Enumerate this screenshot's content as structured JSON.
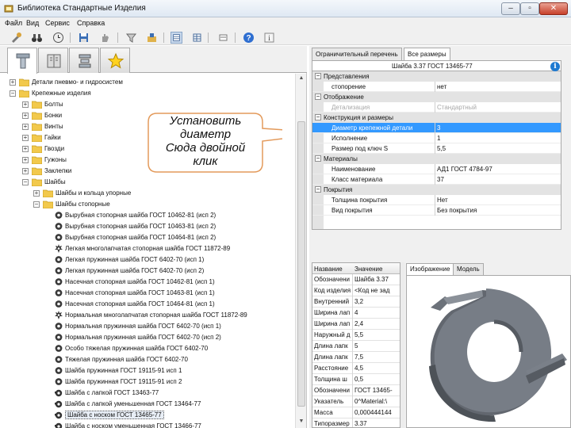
{
  "window": {
    "title": "Библиотека Стандартные Изделия"
  },
  "menu": [
    "Файл",
    "Вид",
    "Сервис",
    "Справка"
  ],
  "toolbar": {
    "icons": [
      "properties-icon",
      "binoculars-icon",
      "clock-icon",
      "save-icon",
      "hand-icon",
      "filter-icon",
      "edit-icon",
      "grid-view-icon",
      "table-view-icon",
      "list-view-icon",
      "help-icon",
      "info-icon"
    ]
  },
  "tree": {
    "rows": [
      {
        "label": "Детали пневмо- и гидросистем",
        "kind": "folder",
        "level": 0,
        "expander": "+"
      },
      {
        "label": "Крепежные изделия",
        "kind": "folder",
        "level": 0,
        "expander": "−"
      },
      {
        "label": "Болты",
        "kind": "folder",
        "level": 1,
        "expander": "+"
      },
      {
        "label": "Бонки",
        "kind": "folder",
        "level": 1,
        "expander": "+"
      },
      {
        "label": "Винты",
        "kind": "folder",
        "level": 1,
        "expander": "+"
      },
      {
        "label": "Гайки",
        "kind": "folder",
        "level": 1,
        "expander": "+"
      },
      {
        "label": "Гвозди",
        "kind": "folder",
        "level": 1,
        "expander": "+"
      },
      {
        "label": "Гужоны",
        "kind": "folder",
        "level": 1,
        "expander": "+"
      },
      {
        "label": "Заклепки",
        "kind": "folder",
        "level": 1,
        "expander": "+"
      },
      {
        "label": "Шайбы",
        "kind": "folder",
        "level": 1,
        "expander": "−"
      },
      {
        "label": "Шайбы и кольца упорные",
        "kind": "folder",
        "level": 2,
        "expander": "+"
      },
      {
        "label": "Шайбы стопорные",
        "kind": "folder",
        "level": 2,
        "expander": "−"
      },
      {
        "label": "Вырубная стопорная шайба ГОСТ 10462-81 (исп 2)",
        "kind": "item",
        "level": 3
      },
      {
        "label": "Вырубная стопорная шайба ГОСТ 10463-81 (исп 2)",
        "kind": "item",
        "level": 3
      },
      {
        "label": "Вырубная стопорная шайба ГОСТ 10464-81 (исп 2)",
        "kind": "item",
        "level": 3
      },
      {
        "label": "Легкая многолапчатая стопорная шайба ГОСТ 11872-89",
        "kind": "item",
        "level": 3
      },
      {
        "label": "Легкая пружинная шайба ГОСТ 6402-70 (исп 1)",
        "kind": "item",
        "level": 3
      },
      {
        "label": "Легкая пружинная шайба ГОСТ 6402-70 (исп 2)",
        "kind": "item",
        "level": 3
      },
      {
        "label": "Насечная стопорная шайба ГОСТ 10462-81 (исп 1)",
        "kind": "item",
        "level": 3
      },
      {
        "label": "Насечная стопорная шайба ГОСТ 10463-81 (исп 1)",
        "kind": "item",
        "level": 3
      },
      {
        "label": "Насечная стопорная шайба ГОСТ 10464-81 (исп 1)",
        "kind": "item",
        "level": 3
      },
      {
        "label": "Нормальная многолапчатая стопорная шайба ГОСТ 11872-89",
        "kind": "item",
        "level": 3
      },
      {
        "label": "Нормальная пружинная шайба ГОСТ 6402-70 (исп 1)",
        "kind": "item",
        "level": 3
      },
      {
        "label": "Нормальная пружинная шайба ГОСТ 6402-70 (исп 2)",
        "kind": "item",
        "level": 3
      },
      {
        "label": "Особо тяжелая пружинная шайба ГОСТ 6402-70",
        "kind": "item",
        "level": 3
      },
      {
        "label": "Тяжелая пружинная шайба ГОСТ 6402-70",
        "kind": "item",
        "level": 3
      },
      {
        "label": "Шайба пружинная ГОСТ 19115-91 исп 1",
        "kind": "item",
        "level": 3
      },
      {
        "label": "Шайба пружинная ГОСТ 19115-91 исп 2",
        "kind": "item",
        "level": 3
      },
      {
        "label": "Шайба с лапкой ГОСТ 13463-77",
        "kind": "item",
        "level": 3
      },
      {
        "label": "Шайба с лапкой уменьшенная ГОСТ 13464-77",
        "kind": "item",
        "level": 3
      },
      {
        "label": "Шайба с носком ГОСТ 13465-77",
        "kind": "item",
        "level": 3,
        "selected": true
      },
      {
        "label": "Шайба с носком уменьшенная ГОСТ 13466-77",
        "kind": "item",
        "level": 3
      }
    ]
  },
  "right": {
    "tabs": [
      "Ограничительный перечень",
      "Все размеры"
    ],
    "active_tab": 1,
    "header": "Шайба 3.37 ГОСТ 13465-77",
    "grid": [
      {
        "type": "cat",
        "name": "Представления"
      },
      {
        "type": "prop",
        "name": "стопорение",
        "value": "нет"
      },
      {
        "type": "cat",
        "name": "Отображение"
      },
      {
        "type": "prop",
        "name": "Детализация",
        "value": "Стандартный",
        "disabled": true
      },
      {
        "type": "cat",
        "name": "Конструкция и размеры"
      },
      {
        "type": "prop",
        "name": "Диаметр крепежной детали",
        "value": "3",
        "selected": true
      },
      {
        "type": "prop",
        "name": "Исполнение",
        "value": "1"
      },
      {
        "type": "prop",
        "name": "Размер под ключ S",
        "value": "5,5"
      },
      {
        "type": "cat",
        "name": "Материалы"
      },
      {
        "type": "prop",
        "name": "Наименование",
        "value": "АД1 ГОСТ 4784-97"
      },
      {
        "type": "prop",
        "name": "Класс материала",
        "value": "37"
      },
      {
        "type": "cat",
        "name": "Покрытия"
      },
      {
        "type": "prop",
        "name": "Толщина покрытия",
        "value": "Нет"
      },
      {
        "type": "prop",
        "name": "Вид покрытия",
        "value": "Без покрытия"
      }
    ],
    "table": {
      "headers": [
        "Название",
        "Значение"
      ],
      "rows": [
        [
          "Обозначени",
          "Шайба 3.37"
        ],
        [
          "Код изделия",
          "<Код не зад"
        ],
        [
          "Внутренний",
          "3,2"
        ],
        [
          "Ширина лап",
          "4"
        ],
        [
          "Ширина лап",
          "2,4"
        ],
        [
          "Наружный д",
          "5,5"
        ],
        [
          "Длина лапк",
          "5"
        ],
        [
          "Длина лапк",
          "7,5"
        ],
        [
          "Расстояние",
          "4,5"
        ],
        [
          "Толщина ш",
          "0,5"
        ],
        [
          "Обозначени",
          "ГОСТ 13465-"
        ],
        [
          "Указатель",
          "0^Material:\\"
        ],
        [
          "Масса",
          "0,000444144"
        ],
        [
          "Типоразмер",
          "3.37"
        ]
      ]
    },
    "image_tabs": [
      "Изображение",
      "Модель"
    ],
    "active_image_tab": 0
  },
  "callout": {
    "lines": [
      "Установить",
      "диаметр",
      "Сюда двойной",
      "клик"
    ],
    "border_color": "#e39a5b"
  }
}
